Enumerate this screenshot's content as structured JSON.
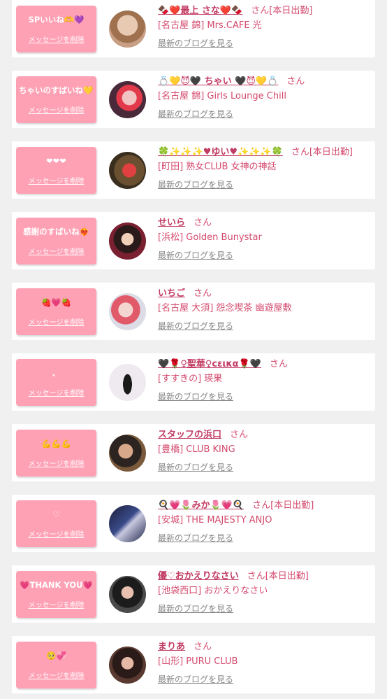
{
  "delete_label": "メッセージを削除",
  "blog_label": "最新のブログを見る",
  "honorific": "さん",
  "cards": [
    {
      "message": "SPいいね🫶💜",
      "name": "🍫❤️最上 さな❤️🍫",
      "tag": "[本日出勤]",
      "shop": "[名古屋 錦] Mrs.CAFE 光"
    },
    {
      "message": "ちゃいのすばいね💛😈🖤",
      "name": "💍💛😈🖤 ちゃい 🖤😈💛💍",
      "tag": "",
      "shop": "[名古屋 錦] Girls Lounge Chill"
    },
    {
      "message": "❤❤❤",
      "name": "🍀✨✨✨♥ゆい♥✨✨✨🍀",
      "tag": "[本日出勤]",
      "shop": "[町田] 熟女CLUB 女神の神話"
    },
    {
      "message": "感謝のすばいね❤️‍🔥",
      "name": "せいら",
      "tag": "",
      "shop": "[浜松] Golden Bunystar"
    },
    {
      "message": "🍓💗🍓",
      "name": "いちご",
      "tag": "",
      "shop": "[名古屋 大須] 怨念喫茶 幽遊屋敷"
    },
    {
      "message": "、",
      "name": "🖤🌹♀聖華♀ϲεικα🌹🖤",
      "tag": "",
      "shop": "[すすきの] 瑛果"
    },
    {
      "message": "💪💪💪",
      "name": "スタッフの浜口",
      "tag": "",
      "shop": "[豊橋] CLUB KING"
    },
    {
      "message": "♡",
      "name": "🍳💗🌷みか🌷💗🍳",
      "tag": "[本日出勤]",
      "shop": "[安城] THE MAJESTY ANJO"
    },
    {
      "message": "💗THANK YOU💗",
      "name": "優♡おかえりなさい",
      "tag": "[本日出勤]",
      "shop": "[池袋西口] おかえりなさい"
    },
    {
      "message": "🥺💞",
      "name": "まりあ",
      "tag": "",
      "shop": "[山形] PURU CLUB"
    }
  ]
}
